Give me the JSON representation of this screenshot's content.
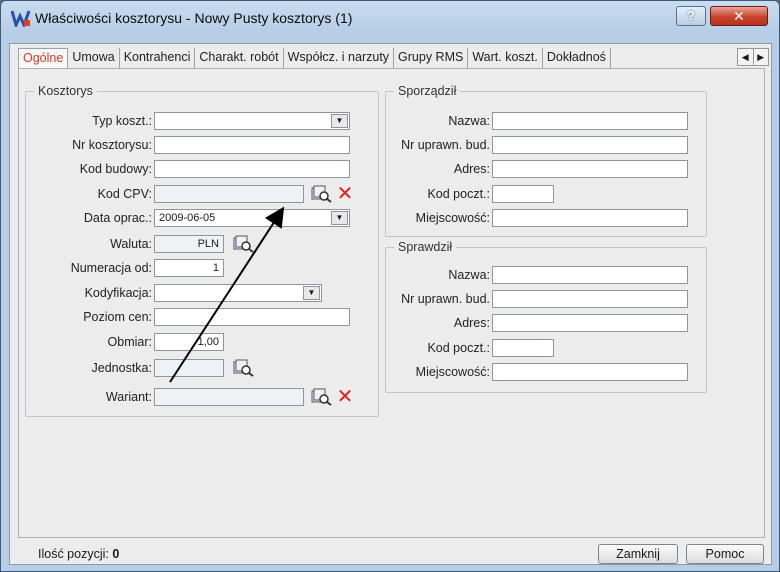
{
  "window": {
    "title": "Właściwości kosztorysu - Nowy  Pusty kosztorys (1)",
    "help_button": "?",
    "close_button": "✕"
  },
  "tabs": [
    "Ogólne",
    "Umowa",
    "Kontrahenci",
    "Charakt. robót",
    "Współcz. i narzuty",
    "Grupy RMS",
    "Wart. koszt.",
    "Dokładnoś"
  ],
  "tab_scroll": {
    "left": "◀",
    "right": "▶"
  },
  "kosztorys": {
    "title": "Kosztorys",
    "typ_label": "Typ koszt.:",
    "typ_value": "",
    "nr_label": "Nr kosztorysu:",
    "nr_value": "",
    "kod_budowy_label": "Kod budowy:",
    "kod_budowy_value": "",
    "kod_cpv_label": "Kod CPV:",
    "kod_cpv_value": "",
    "data_label": "Data oprac.:",
    "data_value": "2009-06-05",
    "waluta_label": "Waluta:",
    "waluta_value": "PLN",
    "numeracja_label": "Numeracja  od:",
    "numeracja_value": "1",
    "kodyfikacja_label": "Kodyfikacja:",
    "kodyfikacja_value": "",
    "poziom_label": "Poziom cen:",
    "poziom_value": "",
    "obmiar_label": "Obmiar:",
    "obmiar_value": "1,00",
    "jednostka_label": "Jednostka:",
    "jednostka_value": "",
    "wariant_label": "Wariant:",
    "wariant_value": ""
  },
  "sporzadzil": {
    "title": "Sporządził",
    "nazwa_label": "Nazwa:",
    "uprawn_label": "Nr uprawn. bud.",
    "adres_label": "Adres:",
    "kod_label": "Kod poczt.:",
    "miejsc_label": "Miejscowość:"
  },
  "sprawdzil": {
    "title": "Sprawdził",
    "nazwa_label": "Nazwa:",
    "uprawn_label": "Nr uprawn. bud.",
    "adres_label": "Adres:",
    "kod_label": "Kod poczt.:",
    "miejsc_label": "Miejscowość:"
  },
  "status": {
    "count_label": "Ilość pozycji:",
    "count_value": "0",
    "zamknij": "Zamknij",
    "pomoc": "Pomoc"
  },
  "colors": {
    "active_tab": "#d03e1e",
    "delete_icon": "#e02020",
    "title_bg": "#c9dcef"
  }
}
